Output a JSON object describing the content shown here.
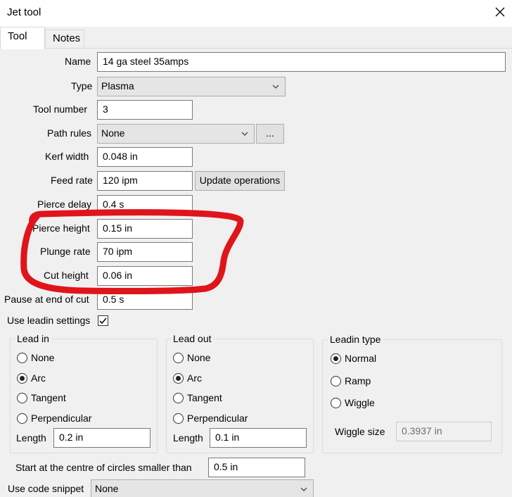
{
  "window": {
    "title": "Jet tool"
  },
  "tabs": [
    {
      "label": "Tool"
    },
    {
      "label": "Notes"
    }
  ],
  "form": {
    "name": {
      "label": "Name",
      "value": "14 ga steel 35amps"
    },
    "type": {
      "label": "Type",
      "value": "Plasma"
    },
    "tool_number": {
      "label": "Tool number",
      "value": "3"
    },
    "path_rules": {
      "label": "Path rules",
      "value": "None",
      "button": "..."
    },
    "kerf_width": {
      "label": "Kerf width",
      "value": "0.048 in"
    },
    "feed_rate": {
      "label": "Feed rate",
      "value": "120 ipm",
      "button": "Update operations"
    },
    "pierce_delay": {
      "label": "Pierce delay",
      "value": "0.4 s"
    },
    "pierce_height": {
      "label": "Pierce height",
      "value": "0.15 in"
    },
    "plunge_rate": {
      "label": "Plunge rate",
      "value": "70 ipm"
    },
    "cut_height": {
      "label": "Cut height",
      "value": "0.06 in"
    },
    "pause_at_end": {
      "label": "Pause at end of cut",
      "value": "0.5 s"
    },
    "use_leadin": {
      "label": "Use leadin settings",
      "checked": true
    }
  },
  "lead_in": {
    "title": "Lead in",
    "options": [
      "None",
      "Arc",
      "Tangent",
      "Perpendicular"
    ],
    "selected": "Arc",
    "length_label": "Length",
    "length_value": "0.2 in"
  },
  "lead_out": {
    "title": "Lead out",
    "options": [
      "None",
      "Arc",
      "Tangent",
      "Perpendicular"
    ],
    "selected": "Arc",
    "length_label": "Length",
    "length_value": "0.1 in"
  },
  "leadin_type": {
    "title": "Leadin type",
    "options": [
      "Normal",
      "Ramp",
      "Wiggle"
    ],
    "selected": "Normal",
    "wiggle_label": "Wiggle size",
    "wiggle_value": "0.3937 in"
  },
  "start_centre": {
    "label": "Start at the centre of circles smaller than",
    "value": "0.5 in"
  },
  "code_snippet": {
    "label": "Use code snippet",
    "value": "None"
  },
  "annotation": {
    "color": "#e0141b"
  },
  "icons": {
    "close": "close-icon",
    "dropdown": "chevron-down-icon",
    "check": "checkmark-icon"
  }
}
